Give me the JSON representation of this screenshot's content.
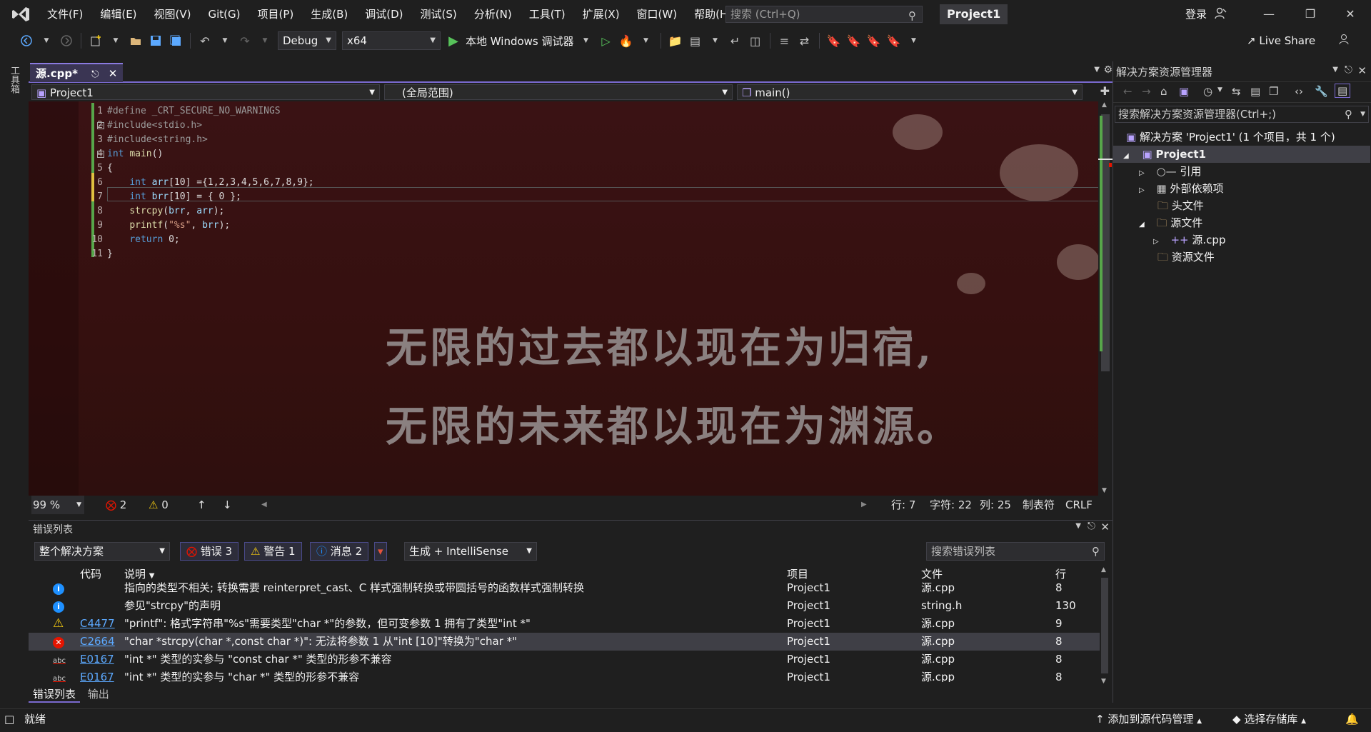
{
  "titlebar": {
    "menus": [
      "文件(F)",
      "编辑(E)",
      "视图(V)",
      "Git(G)",
      "项目(P)",
      "生成(B)",
      "调试(D)",
      "测试(S)",
      "分析(N)",
      "工具(T)",
      "扩展(X)",
      "窗口(W)",
      "帮助(H)"
    ],
    "search_placeholder": "搜索 (Ctrl+Q)",
    "project": "Project1",
    "login": "登录"
  },
  "toolbar": {
    "config": "Debug",
    "platform": "x64",
    "run_label": "本地 Windows 调试器",
    "live_share": "Live Share"
  },
  "toolbox_label": "工具箱",
  "doc": {
    "tab_name": "源.cpp*",
    "project_combo": "Project1",
    "scope_combo": "(全局范围)",
    "member_combo": "main()"
  },
  "code_lines": [
    {
      "n": "1",
      "text": "#define _CRT_SECURE_NO_WARNINGS"
    },
    {
      "n": "2",
      "text": "#include<stdio.h>"
    },
    {
      "n": "3",
      "text": "#include<string.h>"
    },
    {
      "n": "4",
      "text": "int main()"
    },
    {
      "n": "5",
      "text": "{"
    },
    {
      "n": "6",
      "text": "    int arr[10] ={1,2,3,4,5,6,7,8,9};"
    },
    {
      "n": "7",
      "text": "    int brr[10] = { 0 };"
    },
    {
      "n": "8",
      "text": "    strcpy(brr, arr);"
    },
    {
      "n": "9",
      "text": "    printf(\"%s\", brr);"
    },
    {
      "n": "10",
      "text": "    return 0;"
    },
    {
      "n": "11",
      "text": "}"
    }
  ],
  "wallpaper": {
    "line1": "无限的过去都以现在为归宿,",
    "line2": "无限的未来都以现在为渊源。"
  },
  "editor_status": {
    "zoom": "99 %",
    "errors": "2",
    "warnings": "0",
    "row": "行: 7",
    "char": "字符: 22",
    "col": "列: 25",
    "tabs": "制表符",
    "eol": "CRLF"
  },
  "error_list": {
    "title": "错误列表",
    "scope": "整个解决方案",
    "errors_btn": "错误 3",
    "warnings_btn": "警告 1",
    "messages_btn": "消息 2",
    "source": "生成 + IntelliSense",
    "search_placeholder": "搜索错误列表",
    "headers": {
      "code": "代码",
      "desc": "说明",
      "project": "项目",
      "file": "文件",
      "line": "行"
    },
    "rows": [
      {
        "icon": "info",
        "code": "",
        "desc": "指向的类型不相关; 转换需要 reinterpret_cast、C 样式强制转换或带圆括号的函数样式强制转换",
        "project": "Project1",
        "file": "源.cpp",
        "line": "8"
      },
      {
        "icon": "info",
        "code": "",
        "desc": "参见\"strcpy\"的声明",
        "project": "Project1",
        "file": "string.h",
        "line": "130"
      },
      {
        "icon": "warning",
        "code": "C4477",
        "desc": "\"printf\": 格式字符串\"%s\"需要类型\"char *\"的参数，但可变参数 1 拥有了类型\"int *\"",
        "project": "Project1",
        "file": "源.cpp",
        "line": "9"
      },
      {
        "icon": "error",
        "code": "C2664",
        "desc": "\"char *strcpy(char *,const char *)\": 无法将参数 1 从\"int [10]\"转换为\"char *\"",
        "project": "Project1",
        "file": "源.cpp",
        "line": "8"
      },
      {
        "icon": "abc",
        "code": "E0167",
        "desc": "\"int *\" 类型的实参与 \"const char *\" 类型的形参不兼容",
        "project": "Project1",
        "file": "源.cpp",
        "line": "8"
      },
      {
        "icon": "abc",
        "code": "E0167",
        "desc": "\"int *\" 类型的实参与 \"char *\" 类型的形参不兼容",
        "project": "Project1",
        "file": "源.cpp",
        "line": "8"
      }
    ],
    "tabs": [
      "错误列表",
      "输出"
    ]
  },
  "solution": {
    "title": "解决方案资源管理器",
    "search_placeholder": "搜索解决方案资源管理器(Ctrl+;)",
    "root": "解决方案 'Project1' (1 个项目，共 1 个)",
    "project": "Project1",
    "items": [
      "引用",
      "外部依赖项",
      "头文件",
      "源文件",
      "源.cpp",
      "资源文件"
    ]
  },
  "statusbar": {
    "ready": "就绪",
    "add_source": "添加到源代码管理",
    "select_repo": "选择存储库"
  },
  "colors": {
    "accent": "#7a6ad0",
    "error": "#e51400",
    "warning": "#f2c811",
    "info": "#1e90ff"
  }
}
